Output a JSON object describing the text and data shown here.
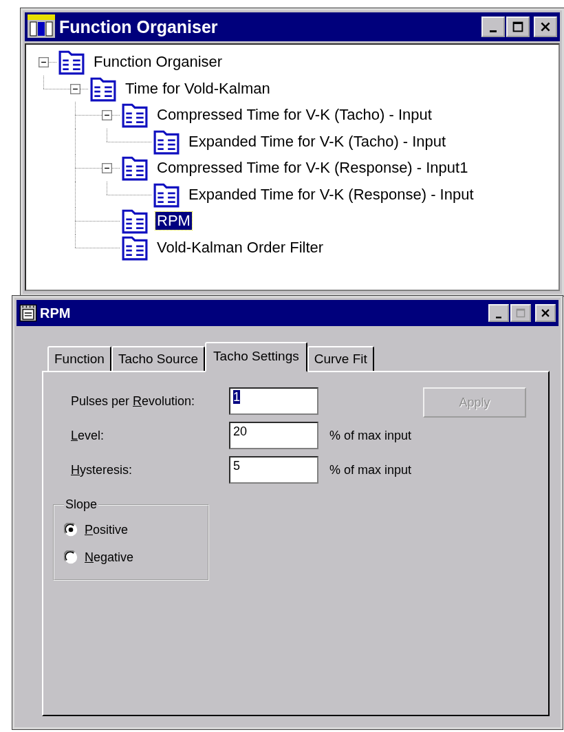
{
  "organiser_window": {
    "title": "Function Organiser",
    "tree": [
      {
        "label": "Function Organiser",
        "expanded": true,
        "selected": false,
        "children": [
          {
            "label": "Time for Vold-Kalman",
            "expanded": true,
            "selected": false,
            "children": [
              {
                "label": "Compressed Time for V-K (Tacho) - Input",
                "expanded": true,
                "selected": false,
                "children": [
                  {
                    "label": "Expanded Time for V-K (Tacho) - Input",
                    "selected": false
                  }
                ]
              },
              {
                "label": "Compressed Time for V-K (Response) - Input1",
                "expanded": true,
                "selected": false,
                "children": [
                  {
                    "label": "Expanded Time for V-K (Response) - Input",
                    "selected": false
                  }
                ]
              },
              {
                "label": "RPM",
                "selected": true
              },
              {
                "label": "Vold-Kalman Order Filter",
                "selected": false
              }
            ]
          }
        ]
      }
    ]
  },
  "rpm_window": {
    "title": "RPM",
    "tabs": [
      {
        "label": "Function",
        "selected": false
      },
      {
        "label": "Tacho Source",
        "selected": false
      },
      {
        "label": "Tacho Settings",
        "selected": true
      },
      {
        "label": "Curve Fit",
        "selected": false
      }
    ],
    "fields": [
      {
        "label_pre": "Pulses per ",
        "label_key": "R",
        "label_post": "evolution:",
        "value": "1",
        "value_selected": true
      },
      {
        "label_key": "L",
        "label_post": "evel:",
        "value": "20",
        "value_selected": false,
        "unit": "% of max input"
      },
      {
        "label_key": "H",
        "label_post": "ysteresis:",
        "value": "5",
        "value_selected": false,
        "unit": "% of max input"
      }
    ],
    "apply_button": {
      "label": "Apply",
      "disabled": true
    },
    "slope": {
      "title": "Slope",
      "options": [
        {
          "label_key": "P",
          "label_post": "ositive",
          "selected": true
        },
        {
          "label_key": "N",
          "label_post": "egative",
          "selected": false
        }
      ]
    }
  }
}
